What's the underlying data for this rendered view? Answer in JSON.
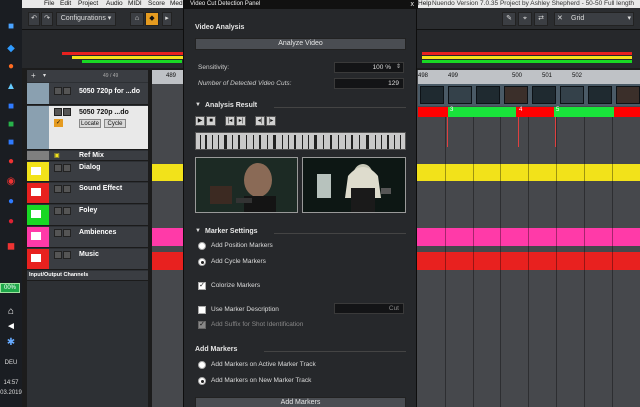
{
  "app": {
    "menu": [
      "File",
      "Edit",
      "Project",
      "Audio",
      "MIDI",
      "Score",
      "Media",
      "Help"
    ],
    "window_title": "Nuendo Version 7.0.35 Project by Ashley Shepherd - 50-50 Full length"
  },
  "toolbar": {
    "configurations_label": "Configurations",
    "grid_label": "Grid"
  },
  "taskbar": {
    "battery_label": "00%",
    "lang": "DEU",
    "time": "14:57",
    "date": "03.2019"
  },
  "tracklist": {
    "header_counter": "49 / 49",
    "tracks": [
      {
        "name": "5050 720p for ...do"
      },
      {
        "name": "5050 720p ...do",
        "locate_label": "Locate",
        "cycle_label": "Cycle"
      },
      {
        "name": "Ref Mix"
      },
      {
        "name": "Dialog"
      },
      {
        "name": "Sound Effect"
      },
      {
        "name": "Foley"
      },
      {
        "name": "Ambiences"
      },
      {
        "name": "Music"
      },
      {
        "name": "Input/Output Channels"
      }
    ]
  },
  "ruler": {
    "ticks_left": [
      "489"
    ],
    "ticks": [
      "498",
      "499",
      "500",
      "501",
      "502"
    ]
  },
  "markers": {
    "numbers": [
      "3",
      "4",
      "5"
    ]
  },
  "panel": {
    "title": "Video Cut Detection Panel",
    "close_glyph": "x",
    "video_analysis": {
      "heading": "Video Analysis",
      "analyze_button": "Analyze Video",
      "sensitivity_label": "Sensitivity:",
      "sensitivity_value": "100 %",
      "cuts_label": "Number of Detected Video Cuts:",
      "cuts_value": "129"
    },
    "analysis_result": {
      "heading": "Analysis Result"
    },
    "marker_settings": {
      "heading": "Marker Settings",
      "add_position": "Add Position Markers",
      "add_cycle": "Add Cycle Markers",
      "colorize": "Colorize Markers",
      "use_description": "Use Marker Description",
      "description_value": "Cut",
      "add_suffix": "Add Suffix for Shot Identification"
    },
    "add_markers": {
      "heading": "Add Markers",
      "on_active": "Add Markers on Active Marker Track",
      "on_new": "Add Markers on New Marker Track",
      "button": "Add Markers"
    }
  },
  "colors": {
    "dialog": "#f2e21a",
    "sound_effect": "#e8211f",
    "foley": "#19d824",
    "ambiences": "#ff3aa8",
    "music": "#e8211f",
    "ref_mix": "#7f7f7f",
    "accent": "#e59b20"
  }
}
